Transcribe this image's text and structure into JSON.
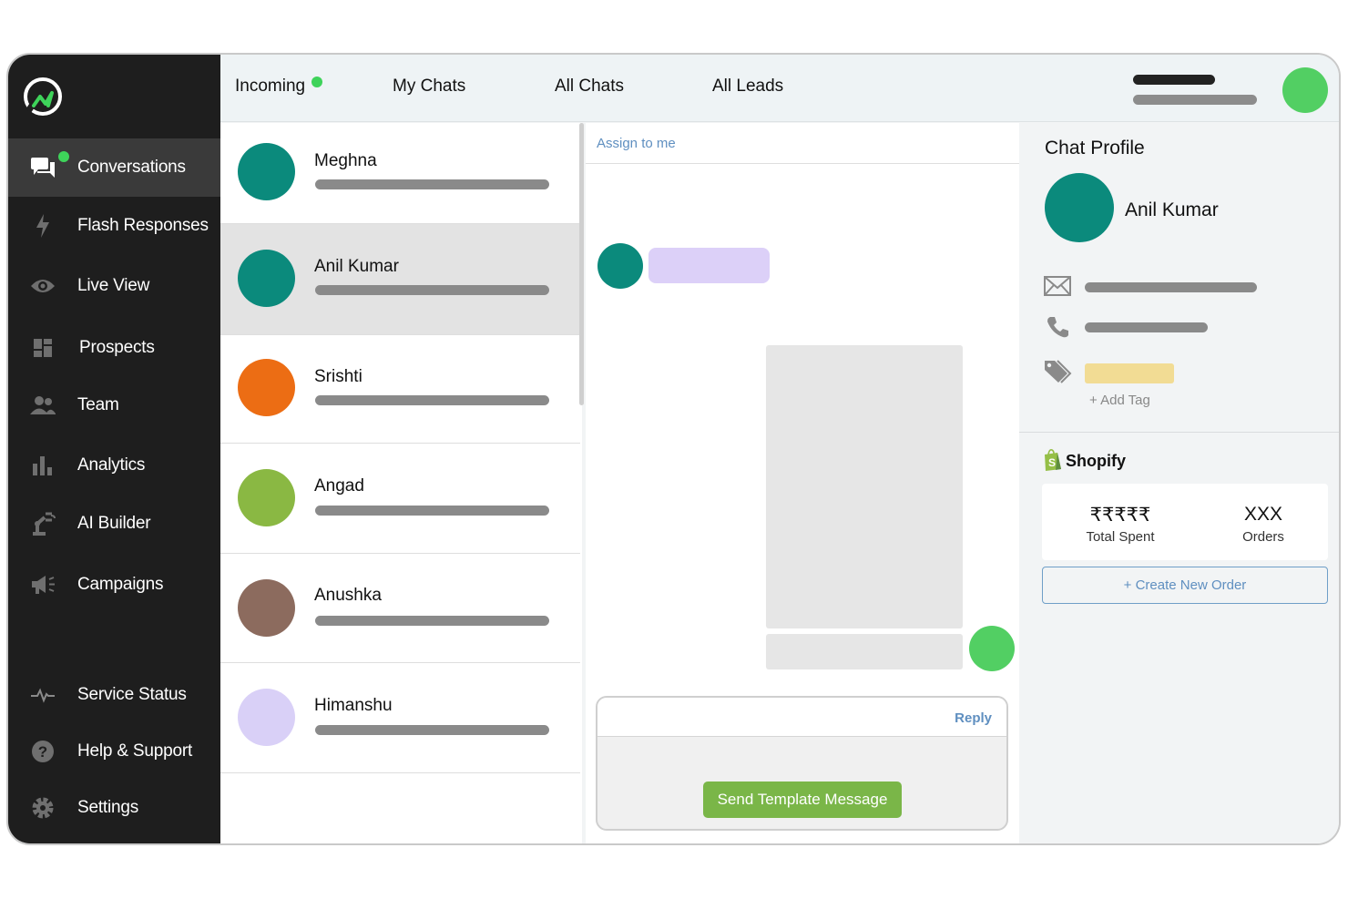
{
  "top_tabs": [
    {
      "label": "Incoming",
      "has_dot": true
    },
    {
      "label": "My Chats"
    },
    {
      "label": "All Chats"
    },
    {
      "label": "All Leads"
    }
  ],
  "sidebar": {
    "items": [
      {
        "label": "Conversations",
        "icon": "chat-bubbles-icon",
        "active": true
      },
      {
        "label": "Flash Responses",
        "icon": "lightning-icon"
      },
      {
        "label": "Live View",
        "icon": "eye-icon"
      },
      {
        "label": "Prospects",
        "icon": "dashboard-grid-icon"
      },
      {
        "label": "Team",
        "icon": "team-icon"
      },
      {
        "label": "Analytics",
        "icon": "bar-chart-icon"
      },
      {
        "label": "AI Builder",
        "icon": "robot-arm-icon"
      },
      {
        "label": "Campaigns",
        "icon": "megaphone-icon"
      },
      {
        "label": "Service Status",
        "icon": "pulse-icon"
      },
      {
        "label": "Help & Support",
        "icon": "help-circle-icon"
      },
      {
        "label": "Settings",
        "icon": "gear-icon"
      }
    ]
  },
  "chats": [
    {
      "name": "Meghna",
      "avatar_color": "#0b8a7c"
    },
    {
      "name": "Anil Kumar",
      "avatar_color": "#0b8a7c",
      "selected": true
    },
    {
      "name": "Srishti",
      "avatar_color": "#ec6d14"
    },
    {
      "name": "Angad",
      "avatar_color": "#8ab843"
    },
    {
      "name": "Anushka",
      "avatar_color": "#8c6b5e"
    },
    {
      "name": "Himanshu",
      "avatar_color": "#d9d0f7"
    }
  ],
  "conversation": {
    "assign_label": "Assign to me",
    "reply_label": "Reply",
    "send_template_label": "Send Template Message"
  },
  "profile": {
    "title": "Chat Profile",
    "name": "Anil Kumar",
    "add_tag_label": "+ Add Tag",
    "shopify_label": "Shopify",
    "total_spent_value": "₹₹₹₹₹",
    "total_spent_label": "Total Spent",
    "orders_value": "XXX",
    "orders_label": "Orders",
    "create_order_label": "+ Create New Order"
  },
  "colors": {
    "sidebar_bg": "#1e1e1e",
    "online_green": "#3ed35a",
    "link_blue": "#5f8fc0",
    "send_button_green": "#7ab648"
  }
}
